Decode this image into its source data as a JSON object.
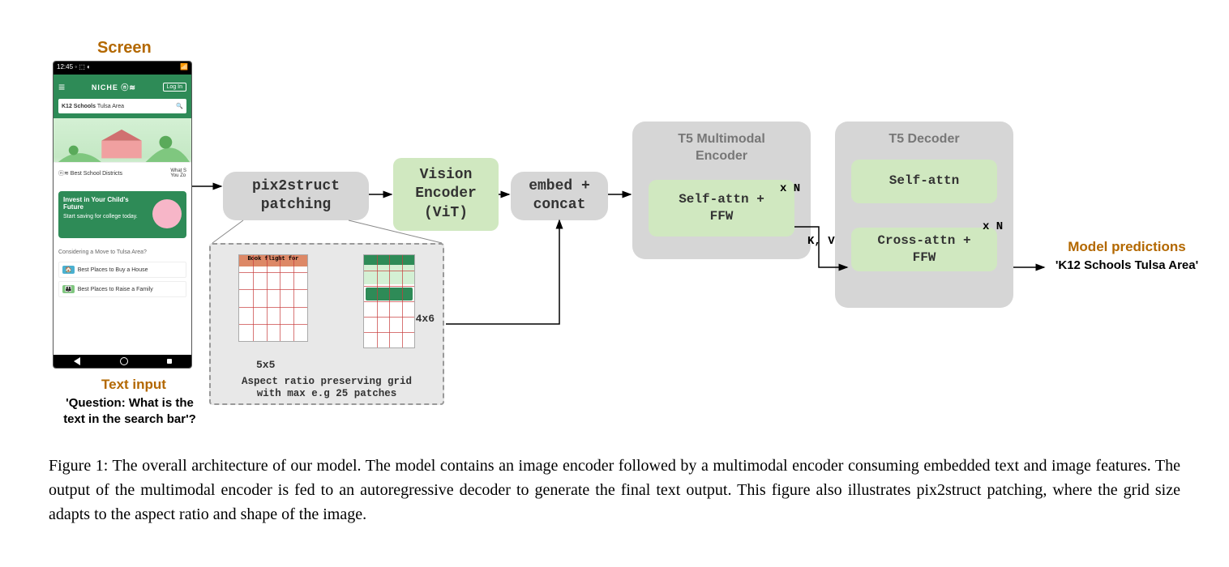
{
  "screen_label": "Screen",
  "text_input_label": "Text input",
  "text_input_content": "'Question: What is the text in the search bar'?",
  "predictions_label": "Model predictions",
  "predictions_content": "'K12 Schools Tulsa Area'",
  "blocks": {
    "pix2struct": "pix2struct\npatching",
    "vit": "Vision\nEncoder\n(ViT)",
    "embed": "embed +\nconcat",
    "t5enc_title": "T5 Multimodal\nEncoder",
    "t5enc_inner": "Self-attn +\nFFW",
    "t5dec_title": "T5 Decoder",
    "t5dec_inner1": "Self-attn",
    "t5dec_inner2": "Cross-attn +\nFFW",
    "xN": "x N",
    "kv": "K, V"
  },
  "patching_detail": {
    "label_5x5": "5x5",
    "label_4x6": "4x6",
    "desc": "Aspect ratio preserving grid\nwith max e.g 25 patches",
    "thumb_a_title": "Book flight for"
  },
  "phone": {
    "time": "12:45",
    "status_icons": "◦ ⬚ ◐",
    "signal": "📶",
    "brand": "NICHE ⓝ≋",
    "login": "Log In",
    "search_bold": "K12 Schools",
    "search_rest": " Tulsa Area",
    "search_icon": "🔍",
    "chip_left": "ⓝ≋  Best School Districts",
    "chip_right": "What S\nYou Zo",
    "card_title": "Invest in Your Child's\nFuture",
    "card_sub": "Start saving for college today.",
    "section": "Considering a Move to Tulsa Area?",
    "row1_icon": "🏠",
    "row1": "Best Places to Buy a House",
    "row2_icon": "👪",
    "row2": "Best Places to Raise a Family"
  },
  "caption": "Figure 1: The overall architecture of our model. The model contains an image encoder followed by a multimodal encoder consuming embedded text and image features. The output of the multimodal encoder is fed to an autoregressive decoder to generate the final text output. This figure also illustrates pix2struct patching, where the grid size adapts to the aspect ratio and shape of the image."
}
